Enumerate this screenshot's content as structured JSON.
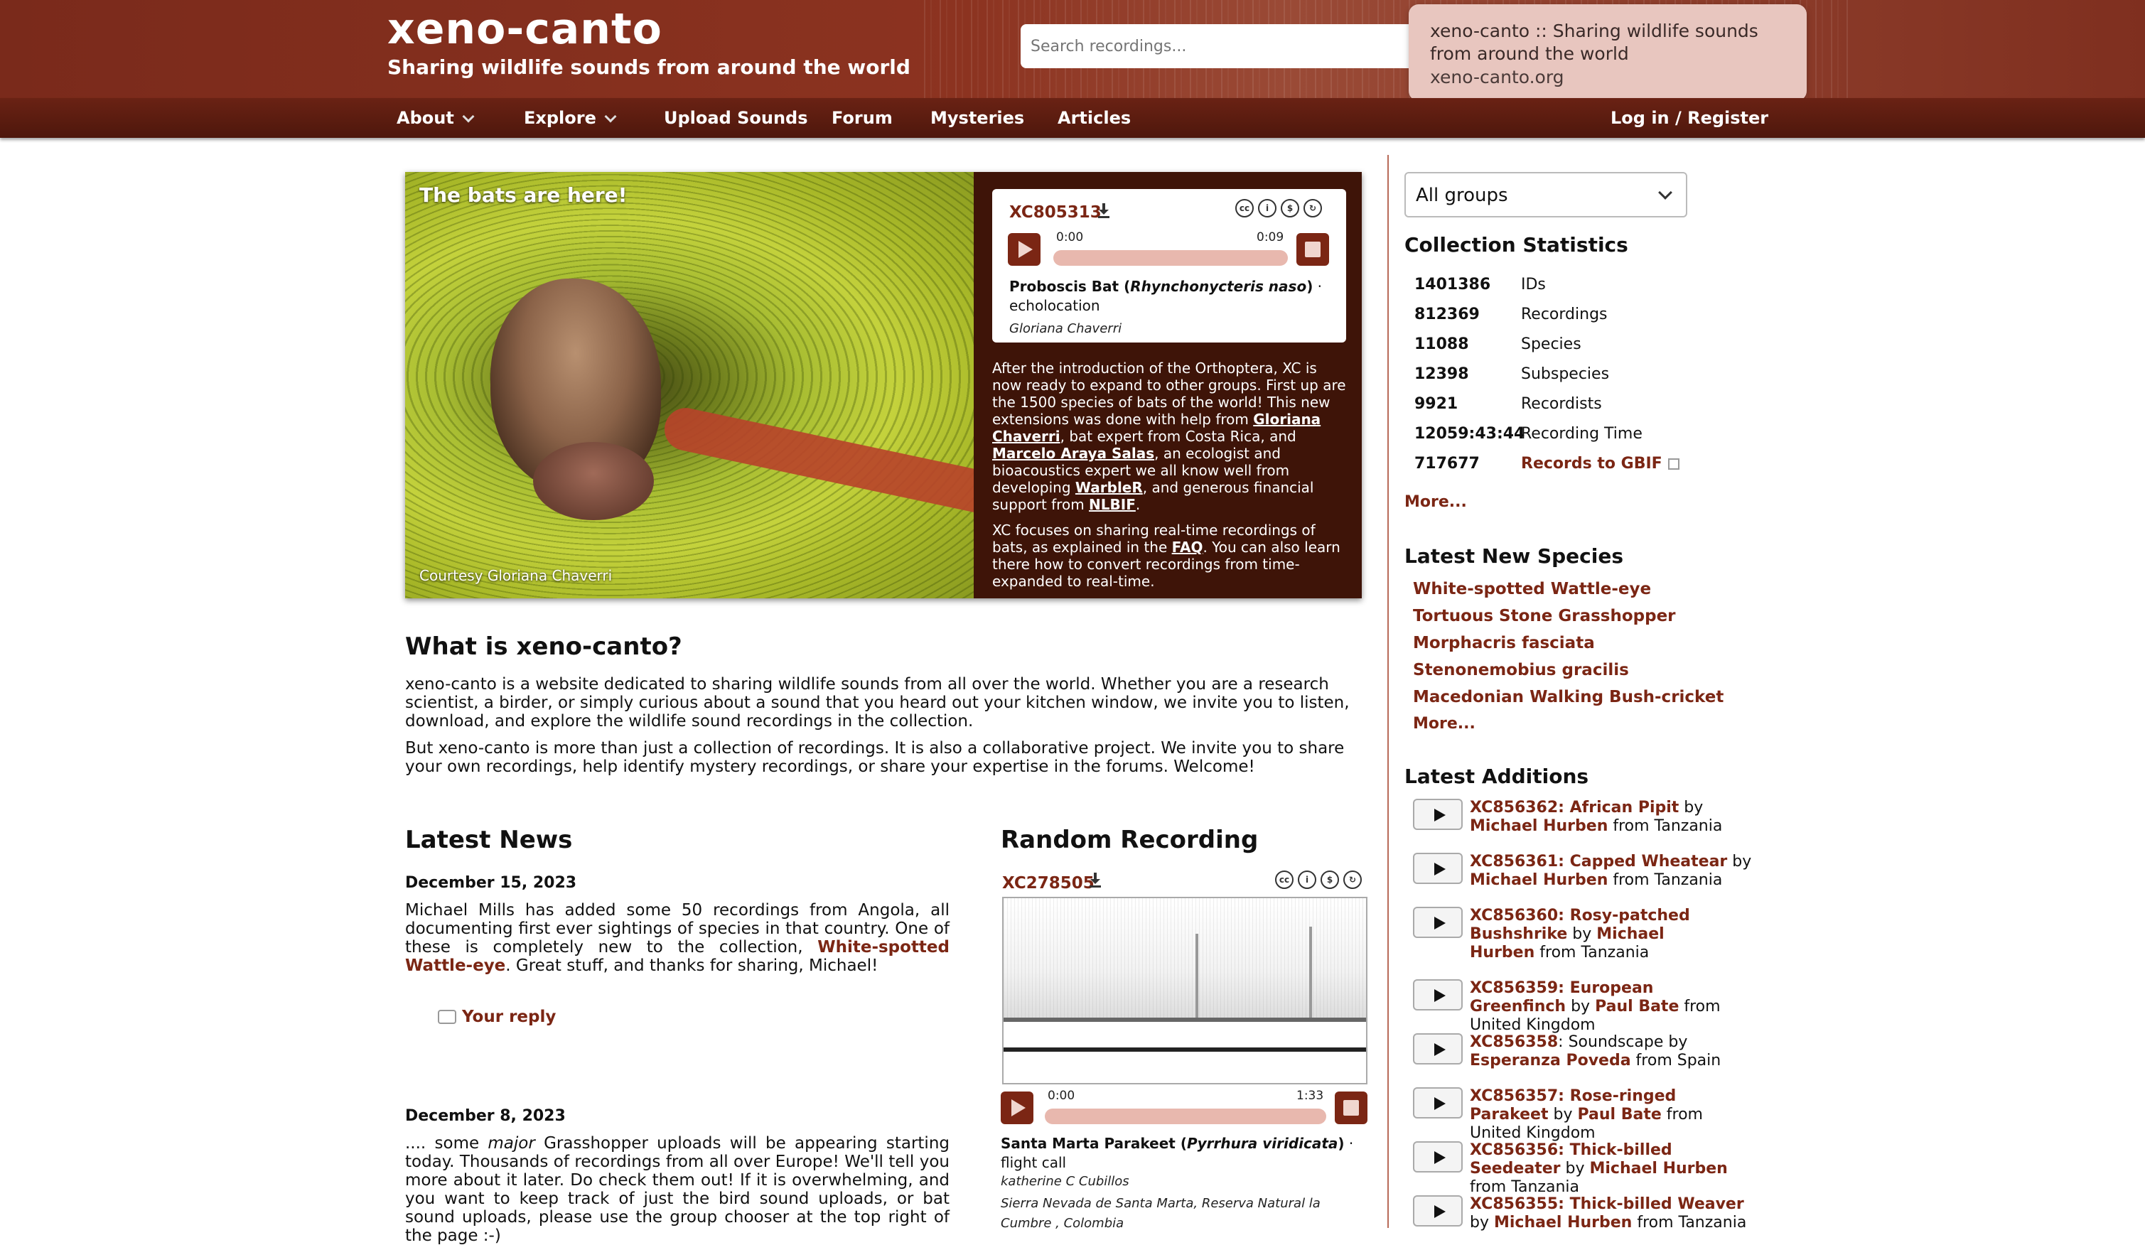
{
  "header": {
    "logo": "xeno-canto",
    "tagline": "Sharing wildlife sounds from around the world",
    "search_placeholder": "Search recordings...",
    "tooltip_title": "xeno-canto :: Sharing wildlife sounds from around the world",
    "tooltip_url": "xeno-canto.org"
  },
  "nav": {
    "about": "About",
    "explore": "Explore",
    "upload": "Upload Sounds",
    "forum": "Forum",
    "mysteries": "Mysteries",
    "articles": "Articles",
    "login": "Log in / Register"
  },
  "banner": {
    "caption_top": "The bats are here!",
    "caption_bottom": "Courtesy Gloriana Chaverri",
    "player": {
      "id": "XC805313",
      "time_start": "0:00",
      "time_end": "0:09",
      "progress": 0,
      "species": "Proboscis Bat",
      "sci": "Rhynchonycteris naso",
      "type": "echolocation",
      "recordist": "Gloriana Chaverri"
    },
    "p1_a": "After the introduction of the Orthoptera, XC is now ready to expand to other groups. First up are the 1500 species of bats of the world! This new extensions was done with help from ",
    "p1_link1": "Gloriana Chaverri",
    "p1_b": ", bat expert from Costa Rica, and ",
    "p1_link2": "Marcelo Araya Salas",
    "p1_c": ", an ecologist and bioacoustics expert we all know well from developing ",
    "p1_link3": "WarbleR",
    "p1_d": ", and generous financial support from ",
    "p1_link4": "NLBIF",
    "p1_e": ".",
    "p2_a": "XC focuses on sharing real-time recordings of bats, as explained in the ",
    "p2_link": "FAQ",
    "p2_b": ". You can also learn there how to convert recordings from time-expanded to real-time."
  },
  "about": {
    "title": "What is xeno-canto?",
    "p1": "xeno-canto is a website dedicated to sharing wildlife sounds from all over the world. Whether you are a research scientist, a birder, or simply curious about a sound that you heard out your kitchen window, we invite you to listen, download, and explore the wildlife sound recordings in the collection.",
    "p2": "But xeno-canto is more than just a collection of recordings. It is also a collaborative project. We invite you to share your own recordings, help identify mystery recordings, or share your expertise in the forums. Welcome!"
  },
  "news": {
    "title": "Latest News",
    "items": [
      {
        "date": "December 15, 2023",
        "text_a": "Michael Mills has added some 50 recordings from Angola, all documenting first ever sightings of species in that country. One of these is completely new to the collection, ",
        "link": "White-spotted Wattle-eye",
        "text_b": ". Great stuff, and thanks for sharing, Michael!",
        "reply": "Your reply"
      },
      {
        "date": "December 8, 2023",
        "text_a": ".... some ",
        "em": "major",
        "text_b": " Grasshopper uploads will be appearing starting today. Thousands of recordings from all over Europe! We'll tell you more about it later. Do check them out! If it is overwhelming, and you want to keep track of just the bird sound uploads, or bat sound uploads, please use the group chooser at the top right of the page :-)"
      }
    ]
  },
  "random": {
    "title": "Random Recording",
    "id": "XC278505",
    "time_start": "0:00",
    "time_end": "1:33",
    "progress": 0,
    "species": "Santa Marta Parakeet",
    "sci": "Pyrrhura viridicata",
    "type": "flight call",
    "recordist": "katherine C Cubillos",
    "location": "Sierra Nevada de Santa Marta, Reserva Natural la Cumbre , Colombia"
  },
  "sidebar": {
    "group_select": "All groups",
    "stats_title": "Collection Statistics",
    "stats": [
      {
        "num": "1401386",
        "label": "IDs"
      },
      {
        "num": "812369",
        "label": "Recordings"
      },
      {
        "num": "11088",
        "label": "Species"
      },
      {
        "num": "12398",
        "label": "Subspecies"
      },
      {
        "num": "9921",
        "label": "Recordists"
      },
      {
        "num": "12059:43:44",
        "label": "Recording Time"
      },
      {
        "num": "717677",
        "label": "Records to GBIF"
      }
    ],
    "more": "More...",
    "species_title": "Latest New Species",
    "species": [
      "White-spotted Wattle-eye",
      "Tortuous Stone Grasshopper",
      "Morphacris fasciata",
      "Stenonemobius gracilis",
      "Macedonian Walking Bush-cricket"
    ],
    "species_more": "More...",
    "additions_title": "Latest Additions",
    "additions": [
      {
        "link": "XC856362: African Pipit",
        "by": " by ",
        "who": "Michael Hurben",
        "from": " from Tanzania"
      },
      {
        "link": "XC856361: Capped Wheatear",
        "by": " by ",
        "who": "Michael Hurben",
        "from": " from Tanzania"
      },
      {
        "link": "XC856360: Rosy-patched Bushshrike",
        "by": " by ",
        "who": "Michael Hurben",
        "from": " from Tanzania"
      },
      {
        "link": "XC856359: European Greenfinch",
        "by": " by ",
        "who": "Paul Bate",
        "from": " from United Kingdom"
      },
      {
        "link": "XC856358",
        "plain": ": Soundscape",
        "by": " by ",
        "who": "Esperanza Poveda",
        "from": " from Spain"
      },
      {
        "link": "XC856357: Rose-ringed Parakeet",
        "by": " by ",
        "who": "Paul Bate",
        "from": " from United Kingdom"
      },
      {
        "link": "XC856356: Thick-billed Seedeater",
        "by": " by ",
        "who": "Michael Hurben",
        "from": " from Tanzania"
      },
      {
        "link": "XC856355: Thick-billed Weaver",
        "by": " by ",
        "who": "Michael Hurben",
        "from": " from Tanzania"
      }
    ]
  }
}
